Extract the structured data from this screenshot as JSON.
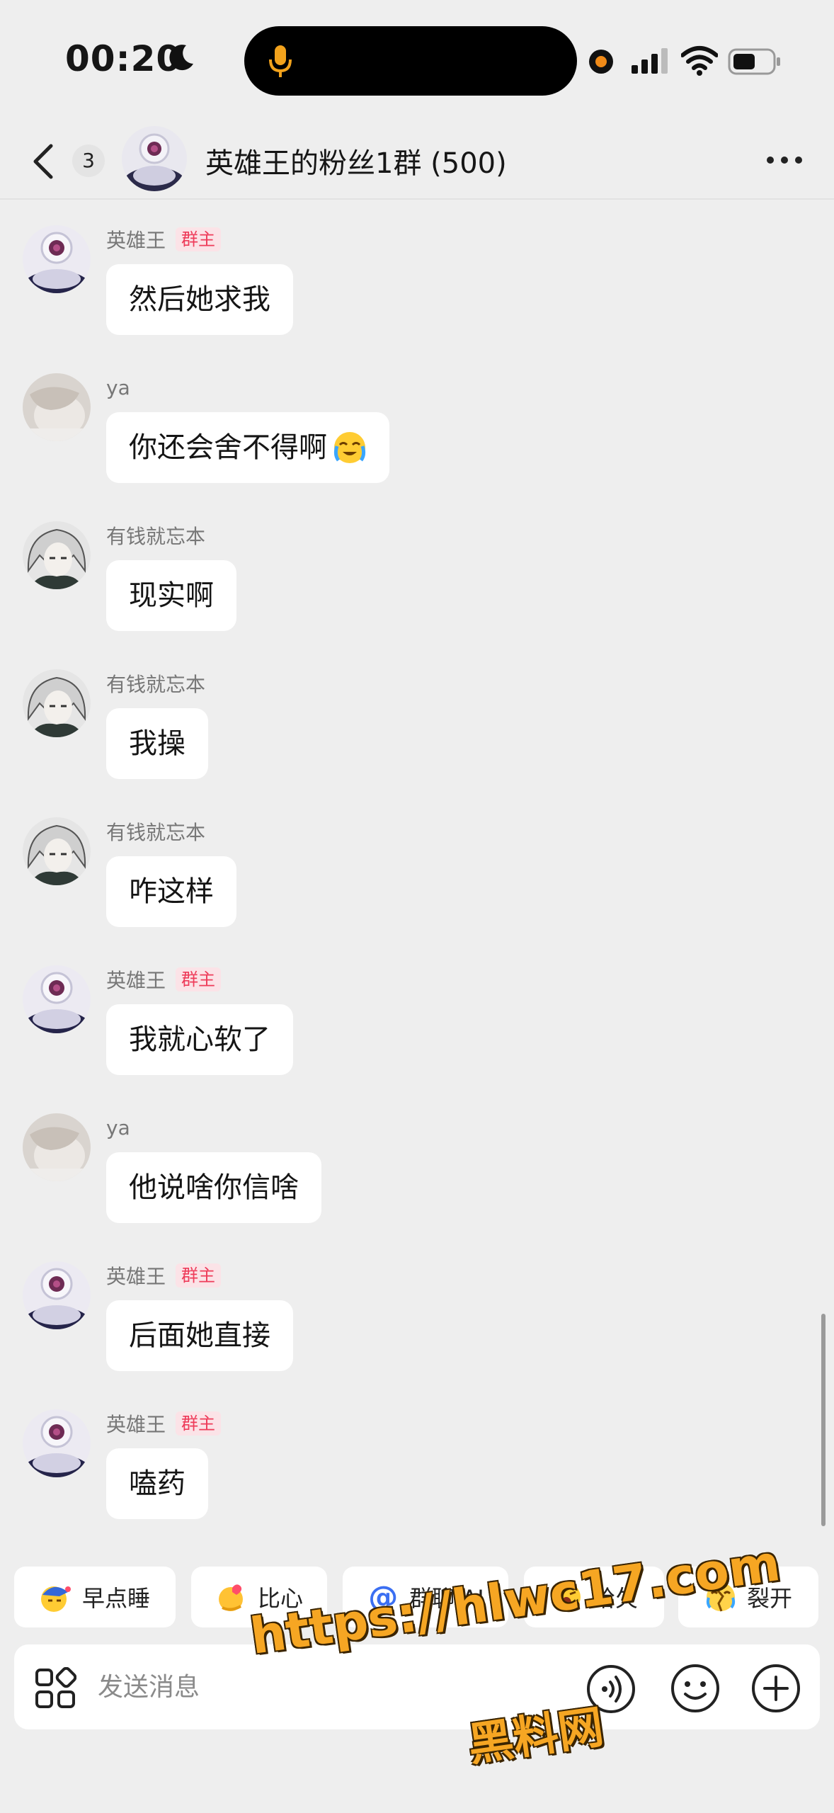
{
  "status_bar": {
    "time": "00:20",
    "icons": [
      "moon-icon",
      "microphone-icon",
      "recording-dot-icon",
      "cellular-signal-icon",
      "wifi-icon",
      "battery-icon"
    ],
    "accent_mic": "#f2a21c"
  },
  "header": {
    "back_icon": "chevron-left-icon",
    "unread_count": "3",
    "title": "英雄王的粉丝1群 (500)",
    "more_icon": "more-dots-icon"
  },
  "messages": [
    {
      "sender": "英雄王",
      "role_tag": "群主",
      "avatar": "hero-avatar",
      "text": "然后她求我"
    },
    {
      "sender": "ya",
      "role_tag": "",
      "avatar": "ya-avatar",
      "text": "你还会舍不得啊"
    },
    {
      "sender": "有钱就忘本",
      "role_tag": "",
      "avatar": "anime-avatar",
      "text": "现实啊"
    },
    {
      "sender": "有钱就忘本",
      "role_tag": "",
      "avatar": "anime-avatar",
      "text": "我操"
    },
    {
      "sender": "有钱就忘本",
      "role_tag": "",
      "avatar": "anime-avatar",
      "text": "咋这样"
    },
    {
      "sender": "英雄王",
      "role_tag": "群主",
      "avatar": "hero-avatar",
      "text": "我就心软了"
    },
    {
      "sender": "ya",
      "role_tag": "",
      "avatar": "ya-avatar",
      "text": "他说啥你信啥"
    },
    {
      "sender": "英雄王",
      "role_tag": "群主",
      "avatar": "hero-avatar",
      "text": "后面她直接"
    },
    {
      "sender": "英雄王",
      "role_tag": "群主",
      "avatar": "hero-avatar",
      "text": "嗑药"
    }
  ],
  "quick_replies": [
    {
      "label": "早点睡",
      "icon": "sleep-emoji-icon"
    },
    {
      "label": "比心",
      "icon": "heart-hands-emoji-icon"
    },
    {
      "label": "群聊 AI",
      "icon": "at-icon"
    },
    {
      "label": "哈欠",
      "icon": "yawn-emoji-icon"
    },
    {
      "label": "裂开",
      "icon": "cracked-emoji-icon"
    }
  ],
  "input": {
    "placeholder": "发送消息",
    "icons": [
      "apps-grid-icon",
      "voice-icon",
      "emoji-face-icon",
      "plus-icon"
    ]
  },
  "watermark": {
    "url": "https://hlwc17.com",
    "site": "黑料网"
  },
  "colors": {
    "background": "#eeeeee",
    "bubble": "#ffffff",
    "owner_tag_text": "#ee3c5a",
    "owner_tag_bg": "#fbe3e7",
    "link_blue": "#3b6ff2",
    "watermark_orange": "#f6a623"
  }
}
